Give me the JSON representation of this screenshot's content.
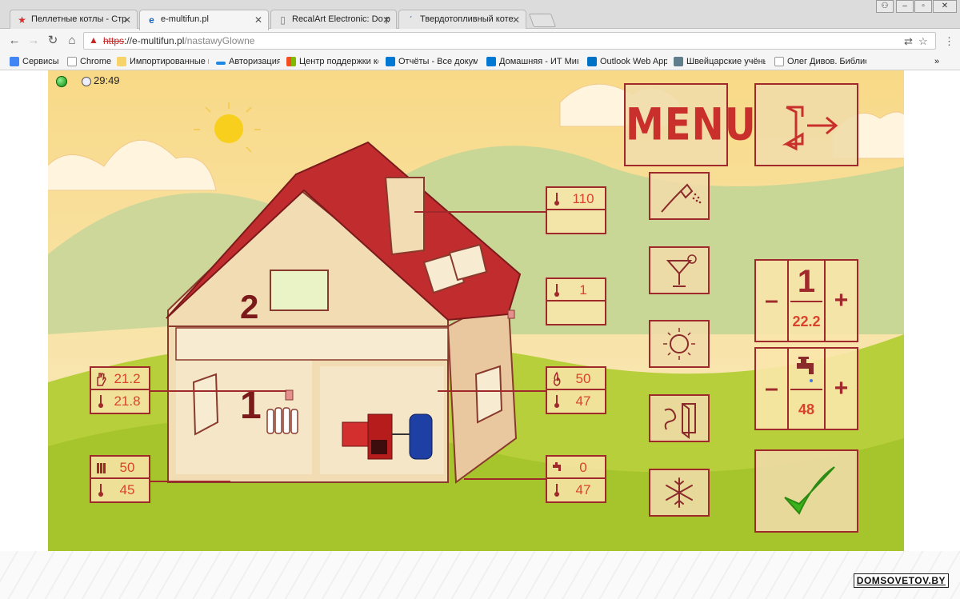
{
  "browser": {
    "tabs": [
      {
        "title": "Пеллетные котлы - Стр",
        "favicon": "star-icon"
      },
      {
        "title": "e-multifun.pl",
        "favicon": "ie-icon"
      },
      {
        "title": "RecalArt Electronic: Do p",
        "favicon": "page-icon"
      },
      {
        "title": "Твердотопливный коте",
        "favicon": "page-icon"
      }
    ],
    "close_glyph": "✕",
    "url_scheme": "https",
    "url_host": "://e-multifun.pl",
    "url_path": "/nastawyGlowne",
    "bookmarks": [
      {
        "label": "Сервисы",
        "color": "#4285f4"
      },
      {
        "label": "Chrome",
        "color": "#ffffff"
      },
      {
        "label": "Импортированные и",
        "color": "#f7d36b"
      },
      {
        "label": "Авторизация",
        "color": "#1e88e5"
      },
      {
        "label": "Центр поддержки кс",
        "color": "#f25022"
      },
      {
        "label": "Отчёты - Все докуме",
        "color": "#0078d4"
      },
      {
        "label": "Домашняя - ИТ Мин",
        "color": "#0078d4"
      },
      {
        "label": "Outlook Web App",
        "color": "#0072c6"
      },
      {
        "label": "Швейцарские учёны",
        "color": "#607d8b"
      },
      {
        "label": "Олег Дивов. Библиот",
        "color": "#ffffff"
      }
    ],
    "bookmarks_more": "»"
  },
  "status": {
    "time": "29:49",
    "led_color": "#19a319"
  },
  "house": {
    "floor1_label": "1",
    "floor2_label": "2"
  },
  "readouts": {
    "chimney_temp": "110",
    "outdoor_temp": "1",
    "room_set": "21.2",
    "room_actual": "21.8",
    "radiator_set": "50",
    "radiator_actual": "45",
    "boiler_set": "50",
    "boiler_actual": "47",
    "dhw_set": "0",
    "dhw_actual": "47"
  },
  "menu": {
    "menu_label": "MENU"
  },
  "controls": {
    "room_number": "1",
    "room_value": "22.2",
    "dhw_value": "48",
    "minus": "–",
    "plus": "+"
  },
  "watermark": "DOMSOVETOV.BY",
  "colors": {
    "accent": "#a0292b",
    "value": "#d9432e",
    "check": "#3bb21b"
  }
}
